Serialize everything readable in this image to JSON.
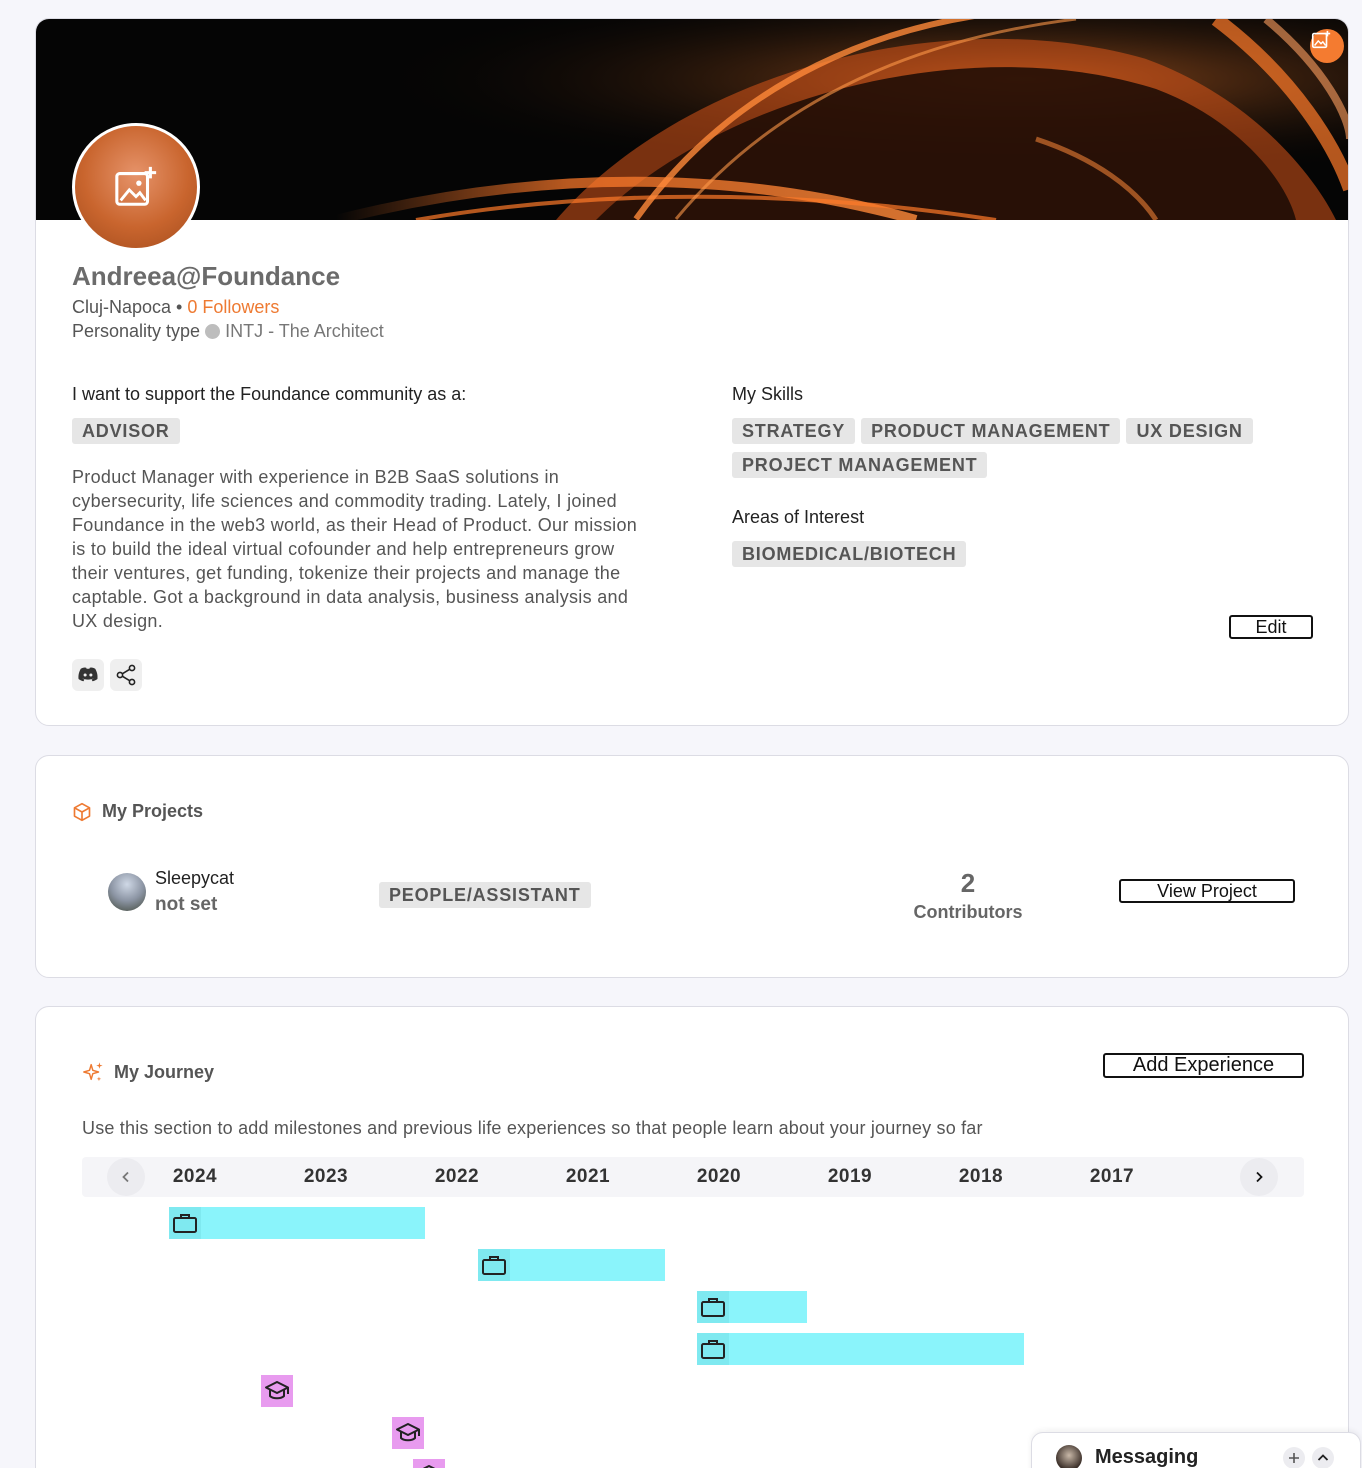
{
  "profile": {
    "name": "Andreea@Foundance",
    "location": "Cluj-Napoca",
    "separator": "•",
    "followers": "0 Followers",
    "personality_label": "Personality type",
    "personality_value": "INTJ - The Architect",
    "support_label": "I want to support the Foundance community as a:",
    "role_tag": "ADVISOR",
    "bio": "Product Manager with experience in B2B SaaS solutions in cybersecurity, life sciences and commodity trading. Lately, I joined Foundance in the web3 world, as their Head of Product. Our mission is to build the ideal virtual cofounder and help entrepreneurs grow their ventures, get funding, tokenize their projects and manage the captable. Got a background in data analysis, business analysis and UX design.",
    "skills_label": "My Skills",
    "skills": [
      "STRATEGY",
      "PRODUCT MANAGEMENT",
      "UX DESIGN",
      "PROJECT MANAGEMENT"
    ],
    "interests_label": "Areas of Interest",
    "interests": [
      "BIOMEDICAL/BIOTECH"
    ],
    "edit_label": "Edit",
    "accent_color": "#ee7a32",
    "social_icons": [
      "discord-icon",
      "share-icon"
    ]
  },
  "projects": {
    "title": "My Projects",
    "items": [
      {
        "name": "Sleepycat",
        "status": "not set",
        "category": "PEOPLE/ASSISTANT",
        "contributors_count": "2",
        "contributors_label": "Contributors",
        "button_label": "View Project"
      }
    ]
  },
  "journey": {
    "title": "My Journey",
    "add_label": "Add Experience",
    "description": "Use this section to add milestones and previous life experiences so that people learn about your journey so far",
    "years": [
      "2024",
      "2023",
      "2022",
      "2021",
      "2020",
      "2019",
      "2018",
      "2017"
    ],
    "work_color": "#8af4fb",
    "education_color": "#e89bef",
    "entries": [
      {
        "type": "work",
        "icon": "briefcase-icon"
      },
      {
        "type": "work",
        "icon": "briefcase-icon"
      },
      {
        "type": "work",
        "icon": "briefcase-icon"
      },
      {
        "type": "work",
        "icon": "briefcase-icon"
      },
      {
        "type": "education",
        "icon": "graduation-cap-icon"
      },
      {
        "type": "education",
        "icon": "graduation-cap-icon"
      },
      {
        "type": "education",
        "icon": "graduation-cap-icon"
      }
    ]
  },
  "messaging": {
    "label": "Messaging"
  }
}
